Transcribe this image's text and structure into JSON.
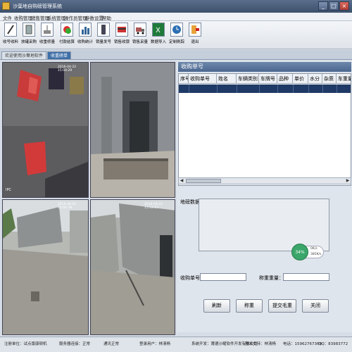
{
  "window": {
    "title": "沙葉地自购磅管理系统",
    "minimize": "_",
    "maximize": "□",
    "close": "×"
  },
  "menu": [
    "文件",
    "收购管理",
    "销售管理",
    "系统管理",
    "操作员管理",
    "参数设置",
    "帮助"
  ],
  "toolbar": [
    {
      "label": "收号收料",
      "icon": "pencil-icon"
    },
    {
      "label": "放罐采购",
      "icon": "tank-icon"
    },
    {
      "label": "收重修量",
      "icon": "scale-icon"
    },
    {
      "label": "付款结算",
      "icon": "coin-icon"
    },
    {
      "label": "收购统计",
      "icon": "chart-icon"
    },
    {
      "label": "销量发号",
      "icon": "phone-icon"
    },
    {
      "label": "销售收银",
      "icon": "card-icon"
    },
    {
      "label": "销售采量",
      "icon": "truck-icon"
    },
    {
      "label": "数据导入",
      "icon": "excel-icon"
    },
    {
      "label": "定制刷踪",
      "icon": "clock-icon"
    },
    {
      "label": "退出",
      "icon": "exit-icon"
    }
  ],
  "tabs": {
    "welcome": "欢迎使用沙葉地软件",
    "weighing": "收重磅单"
  },
  "cameras": {
    "cam1": {
      "timestamp": "2016-04-22 15:04:29",
      "label": "IPC"
    },
    "cam2": {
      "timestamp": ""
    },
    "cam3": {
      "timestamp": "2016-04-22 15:04:39"
    },
    "cam4": {
      "timestamp": "2016-04-22 15:04:57"
    }
  },
  "grid": {
    "title": "收购单号",
    "columns": [
      "序号",
      "收购单号",
      "姓名",
      "车辆类别",
      "车牌号",
      "品种",
      "单价",
      "水分",
      "杂质",
      "车重量"
    ]
  },
  "form": {
    "address_label": "地磅数据：",
    "order_label": "收购单号：",
    "weight_label": "称重重量：",
    "order_value": "",
    "weight_value": ""
  },
  "buttons": {
    "refresh": "刷新",
    "weigh": "称重",
    "submit": "提交毛重",
    "close": "关闭"
  },
  "network": {
    "percent": "34%",
    "up": "0K/s",
    "down": "385K/s"
  },
  "status": {
    "version": "注册单位：试点版康顿机",
    "server": "服务器连接：正常",
    "comm": "通讯正常",
    "ip": "登录用户：林清杨",
    "company": "系统开发：莆德沙耀软件开发有限公司",
    "support": "技术支持：林清杨",
    "phone": "电话：15962767369",
    "qq": "QQ：83983772"
  },
  "colors": {
    "title_bar": "#4b6790",
    "accent": "#3e6fa8",
    "grid_selected_row": "#1f3a66"
  }
}
